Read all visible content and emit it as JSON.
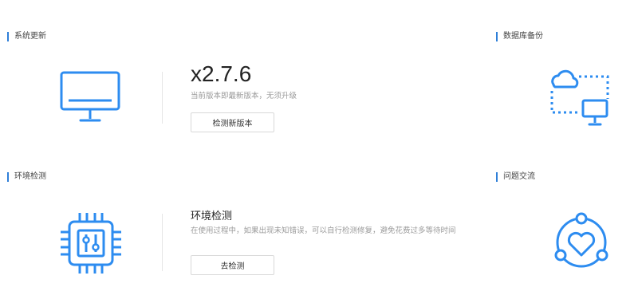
{
  "sections": {
    "system_update": {
      "title": "系统更新",
      "version": "x2.7.6",
      "status": "当前版本即最新版本，无须升级",
      "button": "检测新版本",
      "icon": "monitor-icon"
    },
    "db_backup": {
      "title": "数据库备份",
      "icon": "cloud-sync-icon"
    },
    "env_check": {
      "title": "环境检测",
      "heading": "环境检测",
      "description": "在使用过程中，如果出现未知错误，可以自行检测修复，避免花费过多等待时间",
      "button": "去检测",
      "icon": "chip-icon"
    },
    "feedback": {
      "title": "问题交流",
      "icon": "heart-community-icon"
    }
  },
  "colors": {
    "accent": "#2f7fd8",
    "icon": "#2d8cf0",
    "muted_text": "#9a9a9a"
  }
}
